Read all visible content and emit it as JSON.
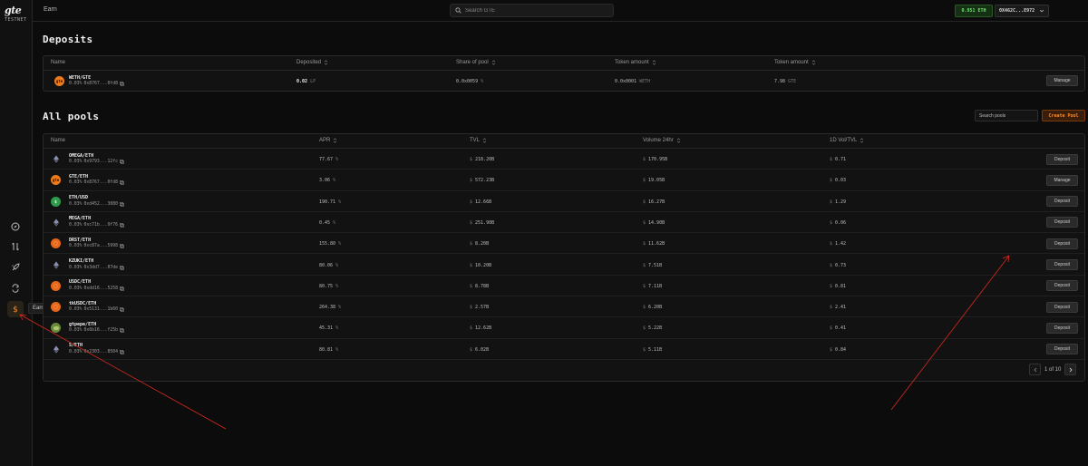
{
  "brand": {
    "logo": "gte",
    "network": "TESTNET"
  },
  "topbar": {
    "breadcrumb": "Earn",
    "search_placeholder": "Search GTE",
    "balance": "0.951 ETH",
    "wallet": "0X462C...E972"
  },
  "sidebar": {
    "tooltip": "Earn"
  },
  "deposits": {
    "title": "Deposits",
    "columns": [
      "Name",
      "Deposited",
      "Share of pool",
      "Token amount",
      "Token amount"
    ],
    "rows": [
      {
        "pair": "WETH/GTE",
        "fee": "0.03%",
        "address": "0x8767...0fd8",
        "deposited": "0.02",
        "deposited_unit": "LP",
        "share": "0.0x0059",
        "share_unit": "%",
        "token1": "0.0x0001",
        "token1_unit": "WETH",
        "token2": "7.98",
        "token2_unit": "GTE",
        "action": "Manage"
      }
    ]
  },
  "pools": {
    "title": "All pools",
    "search_placeholder": "Search pools",
    "create_label": "Create Pool",
    "columns": [
      "Name",
      "APR",
      "TVL",
      "Volume 24hr",
      "1D Vol/TVL"
    ],
    "rows": [
      {
        "pair": "OMEGA/ETH",
        "fee": "0.03%",
        "address": "0x9793...12fc",
        "apr": "77.67",
        "tvl": "218.20B",
        "vol": "170.95B",
        "ratio": "0.71",
        "action": "Deposit",
        "icon": "eth",
        "color": "#1a1a1a"
      },
      {
        "pair": "GTE/ETH",
        "fee": "0.03%",
        "address": "0x8767...0fd8",
        "apr": "3.06",
        "tvl": "572.23B",
        "vol": "19.05B",
        "ratio": "0.03",
        "action": "Manage",
        "icon": "gte",
        "color": "#f07a1a"
      },
      {
        "pair": "ETH/USD",
        "fee": "0.03%",
        "address": "0xd452...3080",
        "apr": "190.71",
        "tvl": "12.66B",
        "vol": "16.27B",
        "ratio": "1.29",
        "action": "Deposit",
        "icon": "usd",
        "color": "#2e9b4a"
      },
      {
        "pair": "MEGA/ETH",
        "fee": "0.03%",
        "address": "0xc71b...9f76",
        "apr": "0.45",
        "tvl": "251.90B",
        "vol": "14.90B",
        "ratio": "0.06",
        "action": "Deposit",
        "icon": "eth",
        "color": "#1a1a1a"
      },
      {
        "pair": "DRST/ETH",
        "fee": "0.03%",
        "address": "0xc87a...5998",
        "apr": "155.80",
        "tvl": "8.20B",
        "vol": "11.62B",
        "ratio": "1.42",
        "action": "Deposit",
        "icon": "coin",
        "color": "#e8671a"
      },
      {
        "pair": "KZUKI/ETH",
        "fee": "0.03%",
        "address": "0x3dd7...07de",
        "apr": "80.06",
        "tvl": "10.20B",
        "vol": "7.51B",
        "ratio": "0.73",
        "action": "Deposit",
        "icon": "eth",
        "color": "#1a1a1a"
      },
      {
        "pair": "USDC/ETH",
        "fee": "0.03%",
        "address": "0xdd16...5258",
        "apr": "80.75",
        "tvl": "8.78B",
        "vol": "7.11B",
        "ratio": "0.81",
        "action": "Deposit",
        "icon": "coin",
        "color": "#e8671a"
      },
      {
        "pair": "tkUSDC/ETH",
        "fee": "0.03%",
        "address": "0x5131...1b60",
        "apr": "264.38",
        "tvl": "2.57B",
        "vol": "6.20B",
        "ratio": "2.41",
        "action": "Deposit",
        "icon": "coin",
        "color": "#e8671a"
      },
      {
        "pair": "gtpepe/ETH",
        "fee": "0.03%",
        "address": "0x6b16...f25b",
        "apr": "45.31",
        "tvl": "12.62B",
        "vol": "5.22B",
        "ratio": "0.41",
        "action": "Deposit",
        "icon": "pepe",
        "color": "#6a8a3a"
      },
      {
        "pair": "S/ETH",
        "fee": "0.03%",
        "address": "0x2303...8504",
        "apr": "80.81",
        "tvl": "6.02B",
        "vol": "5.11B",
        "ratio": "0.84",
        "action": "Deposit",
        "icon": "eth",
        "color": "#1a1a1a"
      }
    ],
    "pagination": "1 of 10"
  },
  "symbols": {
    "dollar": "$",
    "percent": "%"
  },
  "colors": {
    "accent": "#ff8a2a",
    "annotation": "#d8281e",
    "balance": "#6ee86b"
  }
}
